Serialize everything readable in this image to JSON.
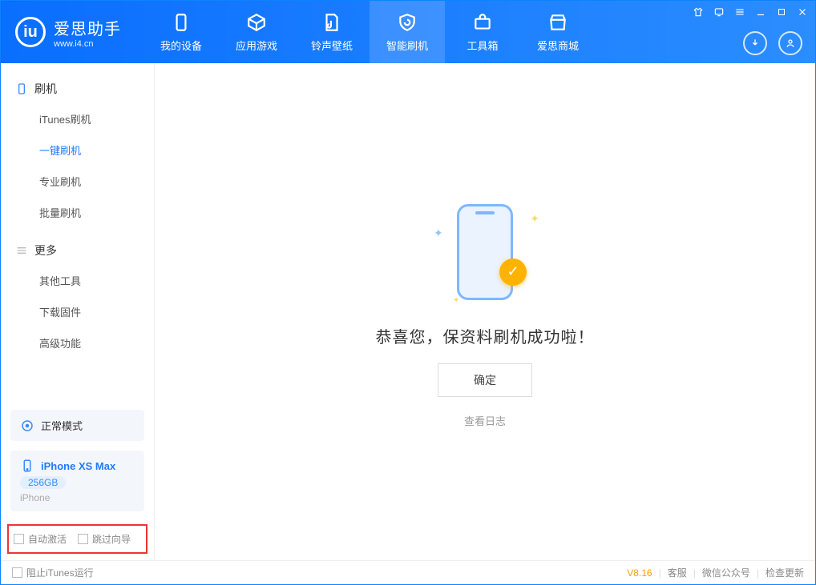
{
  "app": {
    "name": "爱思助手",
    "url": "www.i4.cn"
  },
  "nav": {
    "items": [
      {
        "label": "我的设备"
      },
      {
        "label": "应用游戏"
      },
      {
        "label": "铃声壁纸"
      },
      {
        "label": "智能刷机"
      },
      {
        "label": "工具箱"
      },
      {
        "label": "爱思商城"
      }
    ]
  },
  "sidebar": {
    "section1": {
      "title": "刷机",
      "items": [
        {
          "label": "iTunes刷机"
        },
        {
          "label": "一键刷机"
        },
        {
          "label": "专业刷机"
        },
        {
          "label": "批量刷机"
        }
      ]
    },
    "section2": {
      "title": "更多",
      "items": [
        {
          "label": "其他工具"
        },
        {
          "label": "下载固件"
        },
        {
          "label": "高级功能"
        }
      ]
    },
    "mode": "正常模式",
    "device": {
      "name": "iPhone XS Max",
      "capacity": "256GB",
      "type": "iPhone"
    },
    "checks": {
      "auto_activate": "自动激活",
      "skip_guide": "跳过向导"
    }
  },
  "main": {
    "success": "恭喜您，保资料刷机成功啦！",
    "ok": "确定",
    "view_log": "查看日志"
  },
  "statusbar": {
    "block_itunes": "阻止iTunes运行",
    "version": "V8.16",
    "links": {
      "service": "客服",
      "wechat": "微信公众号",
      "update": "检查更新"
    }
  }
}
